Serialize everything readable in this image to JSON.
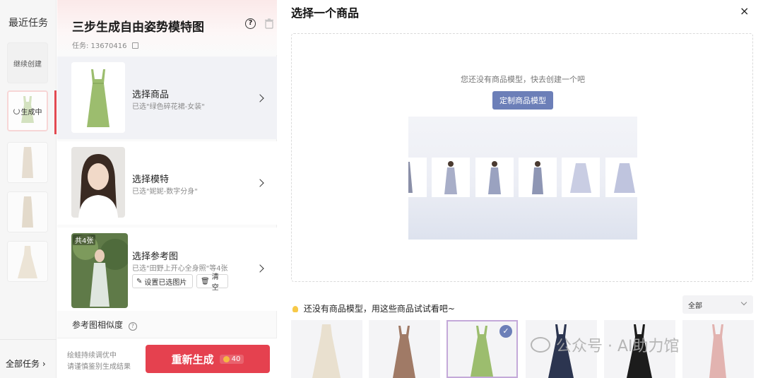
{
  "left": {
    "title": "最近任务",
    "continue_label": "继续创建",
    "generating_label": "生成中",
    "all_tasks_label": "全部任务"
  },
  "middle": {
    "title": "三步生成自由姿势模特图",
    "task_id": "任务: 13670416",
    "steps": [
      {
        "label": "选择商品",
        "sub": "已选\"绿色碎花裙-女装\""
      },
      {
        "label": "选择模特",
        "sub": "已选\"妮妮-数字分身\""
      },
      {
        "label": "选择参考图",
        "sub": "已选\"田野上开心全身照\"等4张",
        "count": "共4张"
      }
    ],
    "set_selected_btn": "设置已选图片",
    "clear_btn": "清空",
    "similarity_label": "参考图相似度",
    "footer_note_1": "绘蛙持续调优中",
    "footer_note_2": "请谨慎鉴别生成结果",
    "regen_label": "重新生成",
    "cost": "40"
  },
  "right": {
    "title": "选择一个商品",
    "close": "×",
    "empty_text": "您还没有商品模型，快去创建一个吧",
    "custom_btn": "定制商品模型",
    "tip": "还没有商品模型，用这些商品试试看吧~",
    "filter_value": "全部"
  },
  "watermark": "公众号 · AI助力馆",
  "colors": {
    "accent_red": "#e5414f",
    "accent_blue": "#6c7fb8",
    "selected_border": "#c4a9d9"
  }
}
